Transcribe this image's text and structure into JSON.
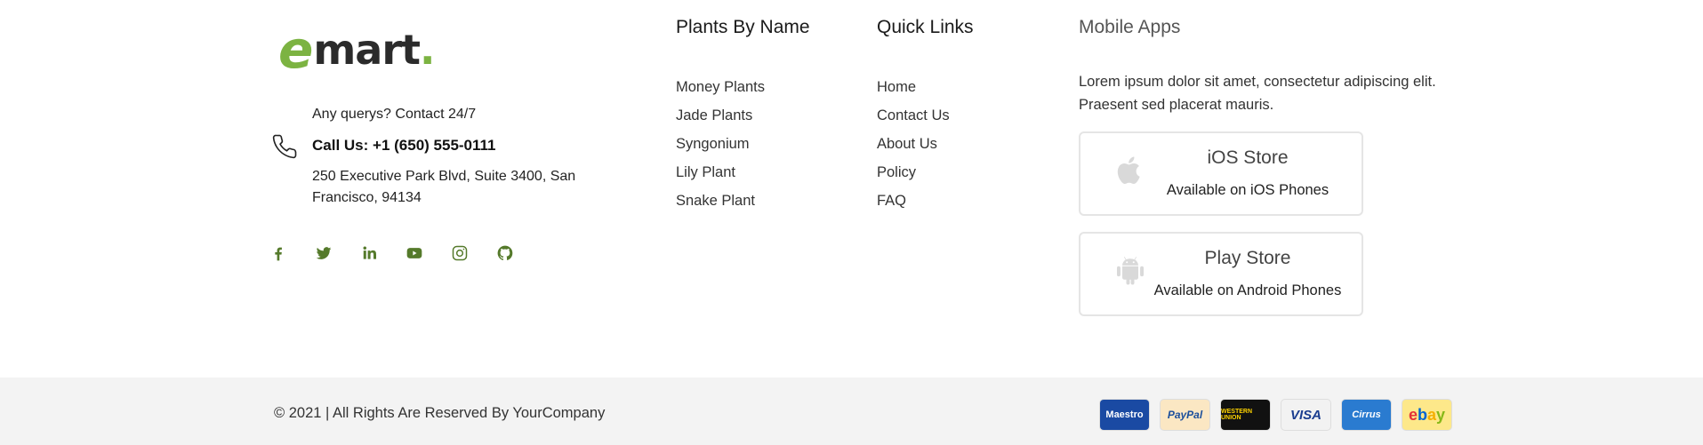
{
  "brand": {
    "logo_e": "e",
    "logo_rest": "mart",
    "logo_dot": "."
  },
  "contact": {
    "query": "Any querys? Contact 24/7",
    "call": "Call Us: +1 (650) 555-0111",
    "address": "250 Executive Park Blvd, Suite 3400, San Francisco, 94134"
  },
  "socials": [
    "facebook-icon",
    "twitter-icon",
    "linkedin-icon",
    "youtube-icon",
    "instagram-icon",
    "github-icon"
  ],
  "plants": {
    "title": "Plants By Name",
    "items": [
      "Money Plants",
      "Jade Plants",
      "Syngonium",
      "Lily Plant",
      "Snake Plant"
    ]
  },
  "quick": {
    "title": "Quick Links",
    "items": [
      "Home",
      "Contact Us",
      "About Us",
      "Policy",
      "FAQ"
    ]
  },
  "apps": {
    "title": "Mobile Apps",
    "description": "Lorem ipsum dolor sit amet, consectetur adipiscing elit. Praesent sed placerat mauris.",
    "ios": {
      "name": "iOS Store",
      "sub": "Available on iOS Phones"
    },
    "android": {
      "name": "Play Store",
      "sub": "Available on Android Phones"
    }
  },
  "footer": {
    "copyright": "© 2021 | All Rights Are Reserved By YourCompany",
    "payments": {
      "maestro": "Maestro",
      "paypal": "PayPal",
      "western_union": "WESTERN UNION",
      "visa": "VISA",
      "cirrus": "Cirrus",
      "ebay": [
        "e",
        "b",
        "a",
        "y"
      ]
    }
  },
  "colors": {
    "brand_green": "#7cb342",
    "social_green": "#557a2b",
    "bottom_bar": "#f3f3f3"
  }
}
